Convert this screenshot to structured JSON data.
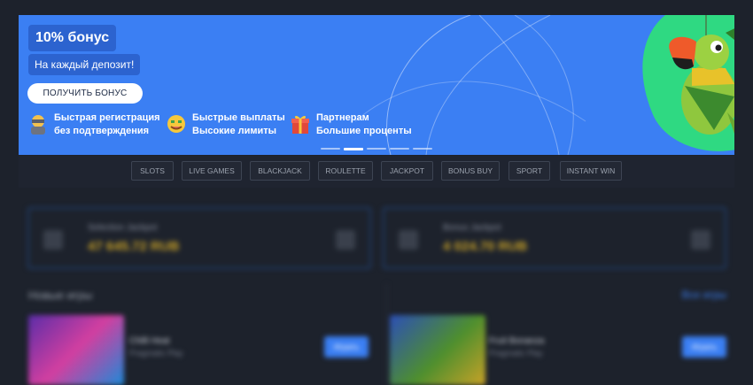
{
  "banner": {
    "bonus_title": "10% бонус",
    "deposit_text": "На каждый депозит!",
    "cta_label": "ПОЛУЧИТЬ БОНУС",
    "features": [
      {
        "line1": "Быстрая регистрация",
        "line2": "без подтверждения",
        "icon": "ninja-avatar-icon"
      },
      {
        "line1": "Быстрые выплаты",
        "line2": "Высокие лимиты",
        "icon": "money-face-icon"
      },
      {
        "line1": "Партнерам",
        "line2": "Большие проценты",
        "icon": "gift-icon"
      }
    ],
    "slides_total": 5,
    "active_slide": 2,
    "colors": {
      "background": "#3b7ff3",
      "badge": "#2c63cf",
      "accent_green": "#2fd982"
    }
  },
  "categories": [
    "SLOTS",
    "LIVE GAMES",
    "BLACKJACK",
    "ROULETTE",
    "JACKPOT",
    "BONUS BUY",
    "SPORT",
    "INSTANT WIN"
  ],
  "jackpots": [
    {
      "title": "Selection Jackpot",
      "amount": "47 645.72 RUB"
    },
    {
      "title": "Bonus Jackpot",
      "amount": "4 024.70 RUB"
    }
  ],
  "new_games": {
    "title": "Новые игры",
    "all_link": "Все игры",
    "items": [
      {
        "name": "Chilli Heat",
        "provider": "Pragmatic Play",
        "button": "Играть"
      },
      {
        "name": "Fruit Bonanza",
        "provider": "Pragmatic Play",
        "button": "Играть"
      }
    ]
  },
  "colors": {
    "page_bg": "#1d222c",
    "category_border": "#3d4453",
    "jackpot_amount": "#c9a227"
  }
}
